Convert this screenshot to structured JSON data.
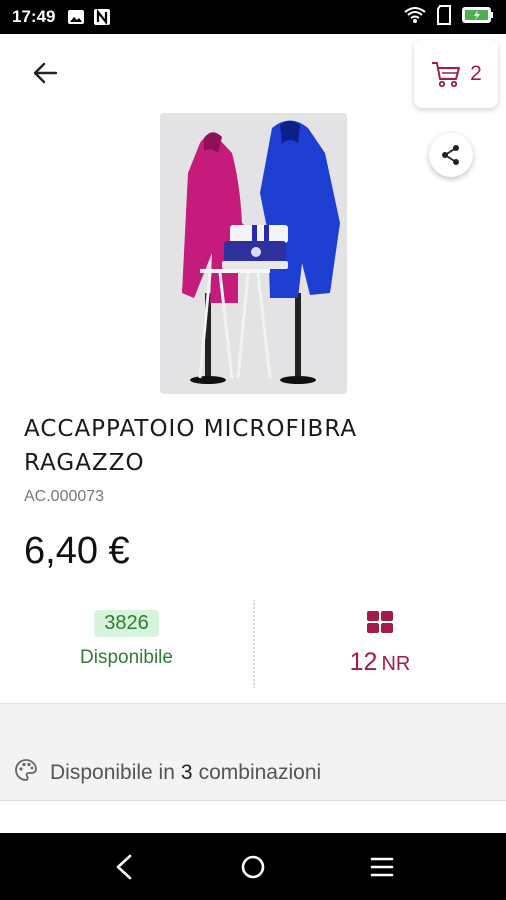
{
  "status_bar": {
    "time": "17:49",
    "icons": [
      "image-icon",
      "n-app-icon",
      "wifi-icon",
      "sim-icon",
      "battery-icon"
    ]
  },
  "header": {
    "back_icon": "arrow-left-icon",
    "cart_icon": "cart-icon",
    "cart_count": "2"
  },
  "product": {
    "image_alt": "Accappatoi microfibra su manichini",
    "title": "ACCAPPATOIO MICROFIBRA RAGAZZO",
    "code": "AC.000073",
    "price": "6,40 €"
  },
  "stock": {
    "quantity": "3826",
    "label": "Disponibile"
  },
  "pack": {
    "icon": "grid-icon",
    "value": "12",
    "unit": "NR"
  },
  "combinations": {
    "prefix": "Disponibile in",
    "count": "3",
    "suffix": "combinazioni",
    "icon": "palette-icon"
  },
  "nav": {
    "back": "nav-back-icon",
    "home": "nav-home-icon",
    "menu": "nav-menu-icon"
  },
  "colors": {
    "accent": "#a21c45",
    "available": "#2e7d32",
    "available_bg": "#d8f3dc"
  }
}
